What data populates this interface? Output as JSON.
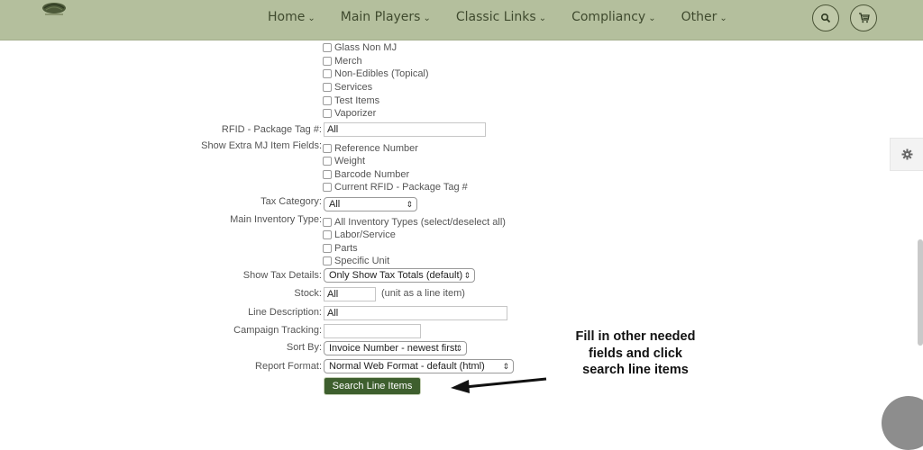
{
  "header": {
    "nav": [
      "Home",
      "Main Players",
      "Classic Links",
      "Compliancy",
      "Other"
    ]
  },
  "form": {
    "item_type_options": [
      "Glass Non MJ",
      "Merch",
      "Non-Edibles (Topical)",
      "Services",
      "Test Items",
      "Vaporizer"
    ],
    "rfid": {
      "label": "RFID - Package Tag #:",
      "value": "All"
    },
    "extra_fields": {
      "label": "Show Extra MJ Item Fields:",
      "options": [
        "Reference Number",
        "Weight",
        "Barcode Number",
        "Current RFID - Package Tag #"
      ]
    },
    "tax_category": {
      "label": "Tax Category:",
      "value": "All"
    },
    "main_inventory_type": {
      "label": "Main Inventory Type:",
      "options": [
        "All Inventory Types (select/deselect all)",
        "Labor/Service",
        "Parts",
        "Specific Unit"
      ]
    },
    "tax_details": {
      "label": "Show Tax Details:",
      "value": "Only Show Tax Totals (default)"
    },
    "stock": {
      "label": "Stock:",
      "value": "All",
      "note": "(unit as a line item)"
    },
    "line_description": {
      "label": "Line Description:",
      "value": "All"
    },
    "campaign_tracking": {
      "label": "Campaign Tracking:",
      "value": ""
    },
    "sort_by": {
      "label": "Sort By:",
      "value": "Invoice Number - newest first"
    },
    "report_format": {
      "label": "Report Format:",
      "value": "Normal Web Format - default (html)"
    },
    "search_button": "Search Line Items"
  },
  "annotation": {
    "lines": [
      "Fill in other needed",
      "fields and click",
      "search line items"
    ]
  }
}
